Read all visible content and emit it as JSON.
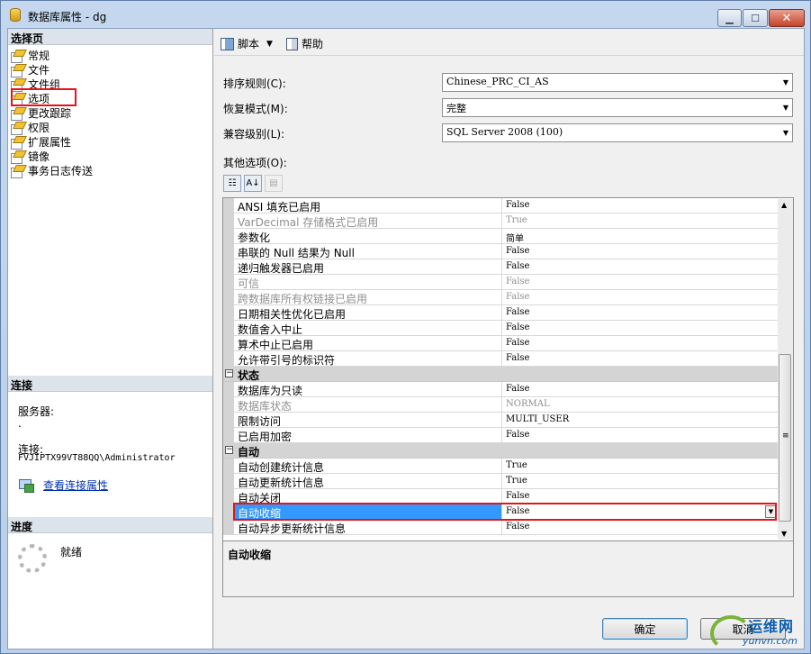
{
  "window": {
    "title": "数据库属性 - dg"
  },
  "left": {
    "select_page_header": "选择页",
    "pages": [
      "常规",
      "文件",
      "文件组",
      "选项",
      "更改跟踪",
      "权限",
      "扩展属性",
      "镜像",
      "事务日志传送"
    ],
    "selected_page": "选项",
    "connection_header": "连接",
    "server_label": "服务器:",
    "server_value": ".",
    "connection_label": "连接:",
    "connection_value": "FVJIPTX99VT88QQ\\Administrator",
    "view_connection_link": "查看连接属性",
    "progress_header": "进度",
    "progress_status": "就绪"
  },
  "toolbar": {
    "script_label": "脚本",
    "help_label": "帮助"
  },
  "options": {
    "collation_label": "排序规则(C):",
    "collation_value": "Chinese_PRC_CI_AS",
    "recovery_label": "恢复模式(M):",
    "recovery_value": "完整",
    "compat_label": "兼容级别(L):",
    "compat_value": "SQL Server 2008 (100)",
    "other_label": "其他选项(O):"
  },
  "grid": {
    "rows": [
      {
        "type": "prop",
        "name": "ANSI 填充已启用",
        "value": "False",
        "disabled": false
      },
      {
        "type": "prop",
        "name": "VarDecimal 存储格式已启用",
        "value": "True",
        "disabled": true
      },
      {
        "type": "prop",
        "name": "参数化",
        "value": "简单",
        "disabled": false
      },
      {
        "type": "prop",
        "name": "串联的 Null 结果为 Null",
        "value": "False",
        "disabled": false
      },
      {
        "type": "prop",
        "name": "递归触发器已启用",
        "value": "False",
        "disabled": false
      },
      {
        "type": "prop",
        "name": "可信",
        "value": "False",
        "disabled": true
      },
      {
        "type": "prop",
        "name": "跨数据库所有权链接已启用",
        "value": "False",
        "disabled": true
      },
      {
        "type": "prop",
        "name": "日期相关性优化已启用",
        "value": "False",
        "disabled": false
      },
      {
        "type": "prop",
        "name": "数值舍入中止",
        "value": "False",
        "disabled": false
      },
      {
        "type": "prop",
        "name": "算术中止已启用",
        "value": "False",
        "disabled": false
      },
      {
        "type": "prop",
        "name": "允许带引号的标识符",
        "value": "False",
        "disabled": false
      },
      {
        "type": "category",
        "name": "状态"
      },
      {
        "type": "prop",
        "name": "数据库为只读",
        "value": "False",
        "disabled": false
      },
      {
        "type": "prop",
        "name": "数据库状态",
        "value": "NORMAL",
        "disabled": true
      },
      {
        "type": "prop",
        "name": "限制访问",
        "value": "MULTI_USER",
        "disabled": false
      },
      {
        "type": "prop",
        "name": "已启用加密",
        "value": "False",
        "disabled": false
      },
      {
        "type": "category",
        "name": "自动"
      },
      {
        "type": "prop",
        "name": "自动创建统计信息",
        "value": "True",
        "disabled": false
      },
      {
        "type": "prop",
        "name": "自动更新统计信息",
        "value": "True",
        "disabled": false
      },
      {
        "type": "prop",
        "name": "自动关闭",
        "value": "False",
        "disabled": false
      },
      {
        "type": "prop",
        "name": "自动收缩",
        "value": "False",
        "disabled": false,
        "selected": true
      },
      {
        "type": "prop",
        "name": "自动异步更新统计信息",
        "value": "False",
        "disabled": false
      }
    ]
  },
  "description": {
    "title": "自动收缩"
  },
  "buttons": {
    "ok": "确定",
    "cancel": "取消"
  },
  "watermark": {
    "main": "运维网",
    "sub": "yunvn.com"
  },
  "colors": {
    "selection": "#3399ff",
    "highlight_annotation": "#e3141b",
    "link": "#0033aa"
  }
}
